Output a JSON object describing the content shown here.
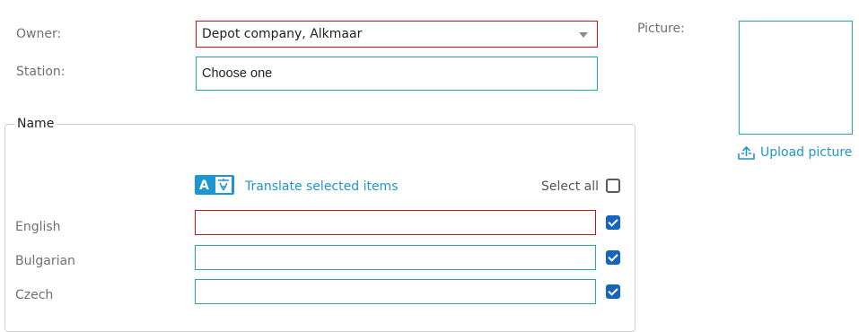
{
  "owner": {
    "label": "Owner:",
    "value": "Depot company, Alkmaar"
  },
  "station": {
    "label": "Station:",
    "value": "Choose one"
  },
  "picture": {
    "label": "Picture:",
    "upload_label": "Upload picture",
    "icon": "upload-icon"
  },
  "name_section": {
    "legend": "Name",
    "translate_label": "Translate selected items",
    "translate_icon": "translate-icon",
    "select_all_label": "Select all",
    "select_all_checked": false,
    "languages": [
      {
        "label": "English",
        "value": "",
        "checked": true
      },
      {
        "label": "Bulgarian",
        "value": "",
        "checked": true
      },
      {
        "label": "Czech",
        "value": "",
        "checked": true
      }
    ]
  },
  "colors": {
    "accent": "#2aa3b3",
    "error": "#c4161c",
    "link": "#2196c9",
    "checkbox": "#1565c0"
  }
}
